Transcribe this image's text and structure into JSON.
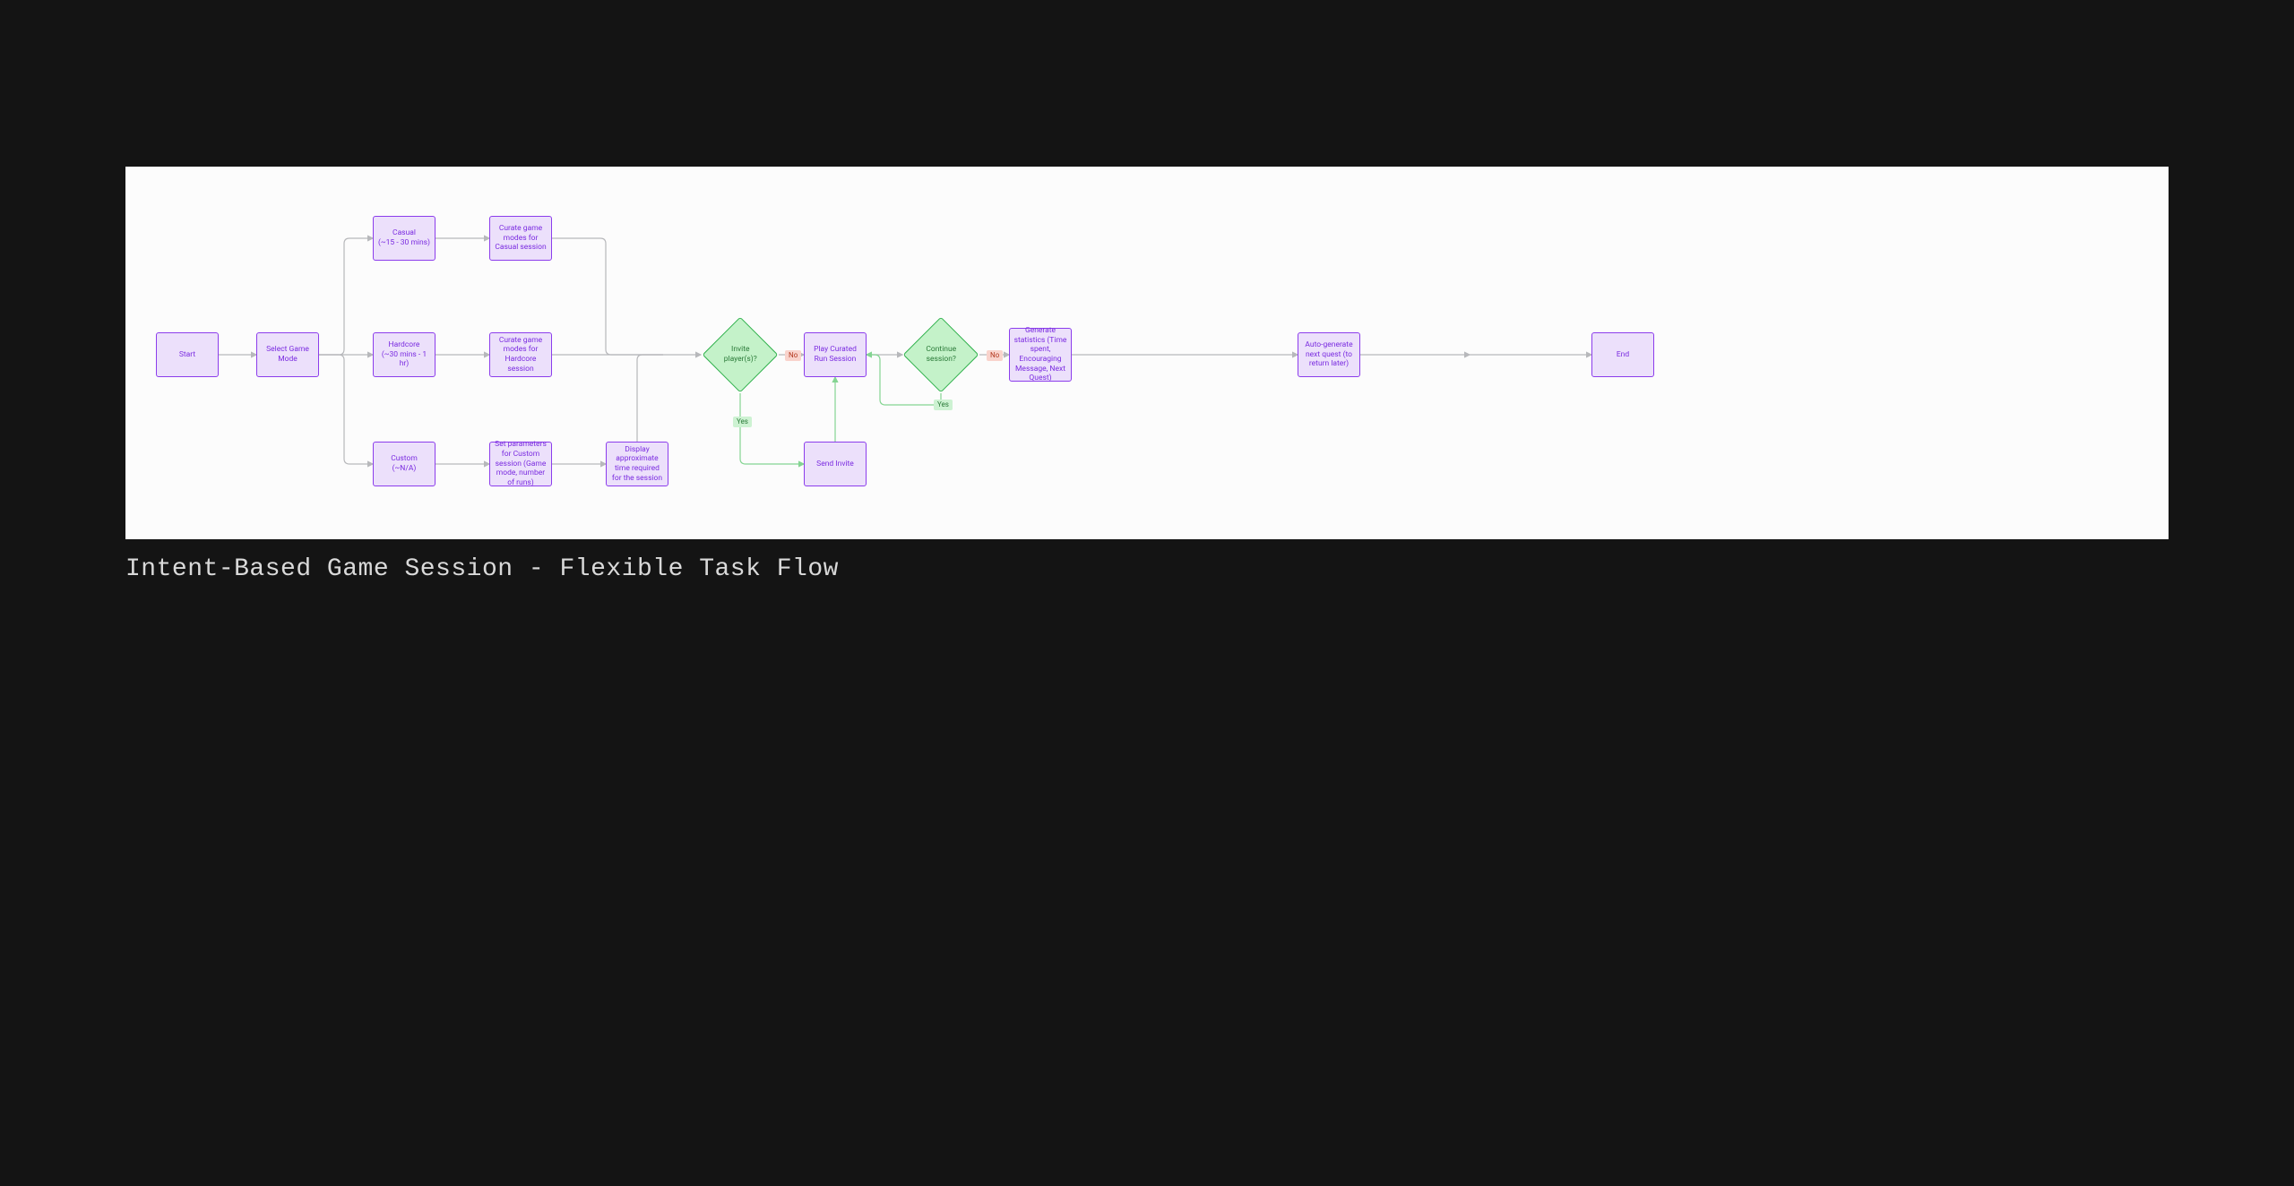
{
  "caption": "Intent-Based Game Session - Flexible Task Flow",
  "nodes": {
    "start": "Start",
    "selectMode": "Select Game Mode",
    "casual": "Casual\n(~15 - 30 mins)",
    "hardcore": "Hardcore\n(~30 mins - 1 hr)",
    "custom": "Custom\n(~N/A)",
    "curateCasual": "Curate game modes for Casual session",
    "curateHardcore": "Curate game modes for Hardcore session",
    "setParams": "Set parameters for Custom session (Game mode, number of runs)",
    "displayTime": "Display approximate time required for the session",
    "invite": "Invite player(s)?",
    "playRun": "Play Curated Run Session",
    "sendInvite": "Send Invite",
    "continue": "Continue session?",
    "genStats": "Generate statistics (Time spent, Encouraging Message, Next Quest)",
    "autoGen": "Auto-generate next quest (to return later)",
    "end": "End"
  },
  "badges": {
    "no": "No",
    "yes": "Yes"
  },
  "colors": {
    "procFill": "#ece0fb",
    "procBorder": "#8c3dec",
    "diamondFill": "#c4f2c9",
    "diamondBorder": "#2db04a",
    "edge": "#b7b8bb",
    "edgeGreen": "#84d492",
    "pageBg": "#141414",
    "canvasBg": "#fcfcfc"
  }
}
